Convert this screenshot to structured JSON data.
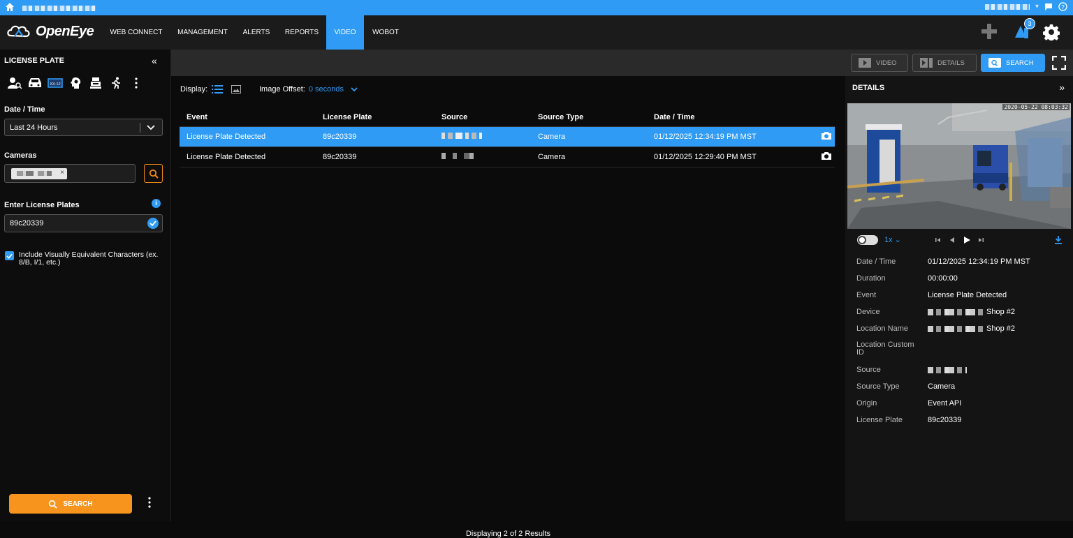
{
  "topbar": {
    "user_label": ""
  },
  "nav": {
    "brand": "OpenEye",
    "items": [
      {
        "label": "WEB CONNECT"
      },
      {
        "label": "MANAGEMENT"
      },
      {
        "label": "ALERTS"
      },
      {
        "label": "REPORTS"
      },
      {
        "label": "VIDEO"
      },
      {
        "label": "WOBOT"
      }
    ],
    "active": "VIDEO",
    "notification_count": "3"
  },
  "sidebar": {
    "title": "LICENSE PLATE",
    "tool_icons": [
      "person-search-icon",
      "car-icon",
      "license-plate-icon",
      "head-icon",
      "register-icon",
      "running-person-icon",
      "more-vertical-icon"
    ],
    "date_time_label": "Date / Time",
    "date_time_value": "Last 24 Hours",
    "cameras_label": "Cameras",
    "plates_label": "Enter License Plates",
    "plate_value": "89c20339",
    "include_checkbox_label": "Include Visually Equivalent Characters (ex. 8/B, I/1, etc.)",
    "include_checked": true,
    "search_label": "SEARCH"
  },
  "toolbar": {
    "video_label": "VIDEO",
    "details_label": "DETAILS",
    "search_label": "SEARCH"
  },
  "results": {
    "display_label": "Display:",
    "offset_label": "Image Offset:",
    "offset_value": "0 seconds",
    "columns": [
      "Event",
      "License Plate",
      "Source",
      "Source Type",
      "Date / Time"
    ],
    "rows": [
      {
        "event": "License Plate Detected",
        "plate": "89c20339",
        "source_type": "Camera",
        "datetime": "01/12/2025 12:34:19 PM MST",
        "selected": true
      },
      {
        "event": "License Plate Detected",
        "plate": "89c20339",
        "source_type": "Camera",
        "datetime": "01/12/2025 12:29:40 PM MST",
        "selected": false
      }
    ],
    "footer": "Displaying 2 of 2 Results"
  },
  "details": {
    "title": "DETAILS",
    "timestamp": "2020-05-22 08:03:32",
    "speed": "1x",
    "fields": [
      {
        "key": "Date / Time",
        "value": "01/12/2025 12:34:19 PM MST"
      },
      {
        "key": "Duration",
        "value": "00:00:00"
      },
      {
        "key": "Event",
        "value": "License Plate Detected"
      },
      {
        "key": "Device",
        "value": "Shop #2"
      },
      {
        "key": "Location Name",
        "value": "Shop #2"
      },
      {
        "key": "Location Custom ID",
        "value": ""
      },
      {
        "key": "Source",
        "value": ""
      },
      {
        "key": "Source Type",
        "value": "Camera"
      },
      {
        "key": "Origin",
        "value": "Event API"
      },
      {
        "key": "License Plate",
        "value": "89c20339"
      }
    ]
  },
  "colors": {
    "accent": "#2f9bf5",
    "search_orange": "#f7941d",
    "nav_bg": "#1b1b1b"
  }
}
